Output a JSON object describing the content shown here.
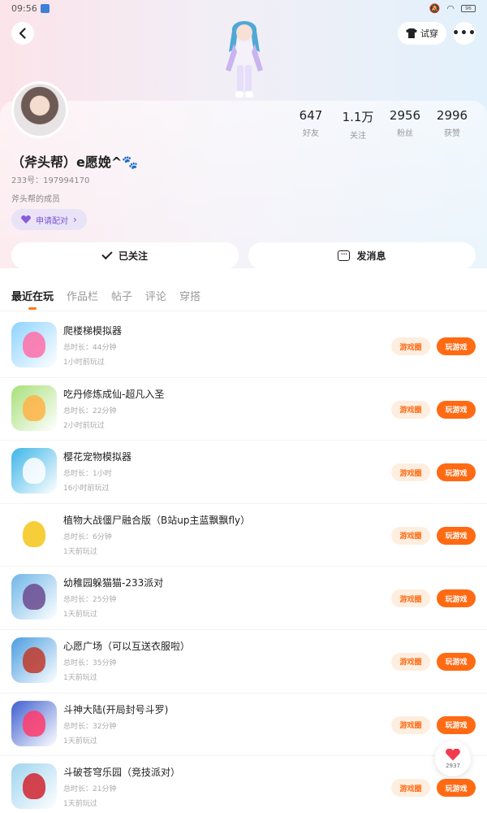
{
  "status_bar": {
    "time": "09:56",
    "battery": "96"
  },
  "header": {
    "tryon_label": "试穿",
    "more_label": "•••"
  },
  "profile": {
    "nickname": "（斧头帮）e愿娩^🐾",
    "user_id": "233号：197994170",
    "bio": "斧头帮的成员",
    "pair_label": "申请配对",
    "stats": [
      {
        "value": "647",
        "label": "好友"
      },
      {
        "value": "1.1万",
        "label": "关注"
      },
      {
        "value": "2956",
        "label": "粉丝"
      },
      {
        "value": "2996",
        "label": "获赞"
      }
    ]
  },
  "actions": {
    "followed_label": "已关注",
    "message_label": "发消息"
  },
  "tabs": [
    "最近在玩",
    "作品栏",
    "帖子",
    "评论",
    "穿搭"
  ],
  "games": [
    {
      "title": "爬楼梯模拟器",
      "duration": "总时长：44分钟",
      "last_played": "1小时前玩过",
      "circle_label": "游戏圈",
      "play_label": "玩游戏",
      "colors": [
        "#8fd3ff",
        "#ff6fa8"
      ]
    },
    {
      "title": "吃丹修炼成仙-超凡入圣",
      "duration": "总时长：22分钟",
      "last_played": "2小时前玩过",
      "circle_label": "游戏圈",
      "play_label": "玩游戏",
      "colors": [
        "#a7e07a",
        "#ffb347"
      ]
    },
    {
      "title": "樱花宠物模拟器",
      "duration": "总时长：1小时",
      "last_played": "16小时前玩过",
      "circle_label": "游戏圈",
      "play_label": "玩游戏",
      "colors": [
        "#3db5e8",
        "#ffffff"
      ]
    },
    {
      "title": "植物大战僵尸融合版（B站up主蓝飘飘fly）",
      "duration": "总时长：6分钟",
      "last_played": "1天前玩过",
      "circle_label": "游戏圈",
      "play_label": "玩游戏",
      "colors": [
        "#ffffff",
        "#f5c518"
      ]
    },
    {
      "title": "幼稚园躲猫猫-233派对",
      "duration": "总时长：25分钟",
      "last_played": "1天前玩过",
      "circle_label": "游戏圈",
      "play_label": "玩游戏",
      "colors": [
        "#6fb6e8",
        "#6b4a8f"
      ]
    },
    {
      "title": "心愿广场（可以互送衣服啦）",
      "duration": "总时长：35分钟",
      "last_played": "1天前玩过",
      "circle_label": "游戏圈",
      "play_label": "玩游戏",
      "colors": [
        "#4a9de0",
        "#c0392b"
      ]
    },
    {
      "title": "斗神大陆(开局封号斗罗)",
      "duration": "总时长：32分钟",
      "last_played": "1天前玩过",
      "circle_label": "游戏圈",
      "play_label": "玩游戏",
      "colors": [
        "#3f5fd0",
        "#ff3b6b"
      ]
    },
    {
      "title": "斗破苍穹乐园（竞技派对）",
      "duration": "总时长：21分钟",
      "last_played": "1天前玩过",
      "circle_label": "游戏圈",
      "play_label": "玩游戏",
      "colors": [
        "#9fd4ee",
        "#d1242f"
      ]
    }
  ],
  "float_like": {
    "count": "2937"
  }
}
